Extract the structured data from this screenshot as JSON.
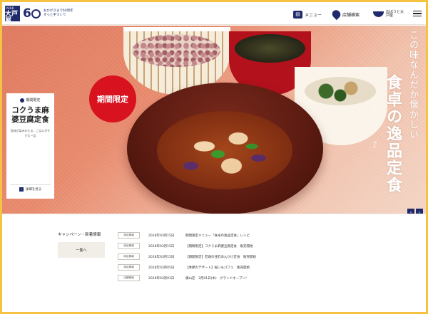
{
  "header": {
    "logo_small": "Since 1966",
    "logo_big": "大戸屋",
    "anniversary_num": "6",
    "anniversary_line1": "おかげさまで60周年",
    "anniversary_line2": "ずっと手づくり",
    "nav": [
      {
        "label": "メニュー",
        "icon": "menu-book-icon"
      },
      {
        "label": "店舗検索",
        "icon": "map-pin-icon"
      },
      {
        "label": "おぼうと大戸屋",
        "icon": "bowl-icon"
      }
    ]
  },
  "hero": {
    "badge": "期間限定",
    "tagline_small": "この味なんだか懐かしい",
    "tagline_big": "食卓の逸品定食",
    "ruby_1": "いっ",
    "ruby_2": "ぴん",
    "promo": {
      "tag": "期間限定",
      "title": "コクうま麻婆豆腐定食",
      "desc": "旨味が染みわたる、ごはんがすすむ一品",
      "more": "詳細を見る"
    },
    "prev": "‹",
    "next": "›"
  },
  "news": {
    "heading": "キャンペーン・新着情報",
    "all_button": "一覧へ",
    "items": [
      {
        "category": "商品情報",
        "date": "2018年03月15日",
        "title": "期間限定メニュー「食卓の逸品定食」レシピ"
      },
      {
        "category": "商品情報",
        "date": "2018年03月15日",
        "title": "【期間限定】コクうま麻婆豆腐定食　販売開始"
      },
      {
        "category": "商品情報",
        "date": "2018年03月15日",
        "title": "【期間限定】若鶏の甘酢あんかけ定食　販売開始"
      },
      {
        "category": "商品情報",
        "date": "2018年03月05日",
        "title": "【季節のデザート】桜いもパフェ　販売開始"
      },
      {
        "category": "店舗情報",
        "date": "2018年03月01日",
        "title": "横山店　3月01日(木)　グランドオープン！"
      }
    ]
  },
  "colors": {
    "brand_navy": "#1f2a6b",
    "badge_red": "#d8121f",
    "frame_yellow": "#f5c341"
  }
}
